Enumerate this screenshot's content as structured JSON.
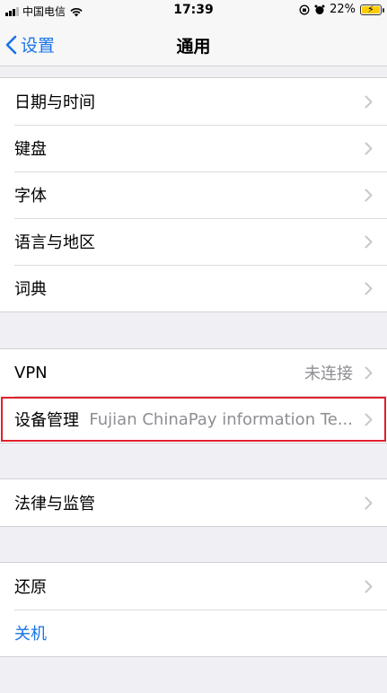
{
  "status_bar": {
    "carrier": "中国电信",
    "time": "17:39",
    "battery": "22%"
  },
  "nav": {
    "back_label": "设置",
    "title": "通用"
  },
  "group1": [
    {
      "label": "日期与时间"
    },
    {
      "label": "键盘"
    },
    {
      "label": "字体"
    },
    {
      "label": "语言与地区"
    },
    {
      "label": "词典"
    }
  ],
  "group2": [
    {
      "label": "VPN",
      "value": "未连接"
    },
    {
      "label": "设备管理",
      "value": "Fujian ChinaPay information Te..."
    }
  ],
  "group3": [
    {
      "label": "法律与监管"
    }
  ],
  "group4": [
    {
      "label": "还原"
    },
    {
      "label": "关机"
    }
  ],
  "colors": {
    "accent": "#1a73e8",
    "highlight_border": "#e0202a"
  }
}
